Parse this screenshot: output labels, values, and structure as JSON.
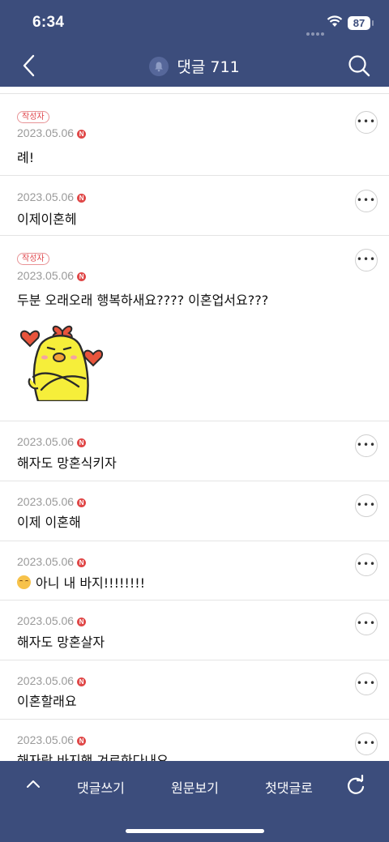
{
  "status_bar": {
    "time": "6:34",
    "battery": "87"
  },
  "nav": {
    "title": "댓글 711"
  },
  "comments": [
    {
      "badge": "작성자",
      "date": "2023.05.06",
      "n_label": "N",
      "text": "례!"
    },
    {
      "date": "2023.05.06",
      "n_label": "N",
      "text": "이제이혼헤"
    },
    {
      "badge": "작성자",
      "date": "2023.05.06",
      "n_label": "N",
      "text": "두분 오래오래 행복하새요???? 이혼업서요???",
      "sticker": "yellow-chick-sticker"
    },
    {
      "date": "2023.05.06",
      "n_label": "N",
      "text": "해자도 망혼식키자"
    },
    {
      "date": "2023.05.06",
      "n_label": "N",
      "text": "이제 이혼해"
    },
    {
      "date": "2023.05.06",
      "n_label": "N",
      "text": "아니 내 바지!!!!!!!!",
      "emoji": "relieved-face"
    },
    {
      "date": "2023.05.06",
      "n_label": "N",
      "text": "해자도 망혼살자"
    },
    {
      "date": "2023.05.06",
      "n_label": "N",
      "text": "이혼할래요"
    },
    {
      "date": "2023.05.06",
      "n_label": "N",
      "text": "해자랑 바지핵 겨로한다내요"
    }
  ],
  "more_label": "•••",
  "bottom_bar": {
    "write": "댓글쓰기",
    "original": "원문보기",
    "first": "첫댓글로"
  },
  "colors": {
    "header": "#3c4d7c",
    "accent_red": "#e04848"
  }
}
